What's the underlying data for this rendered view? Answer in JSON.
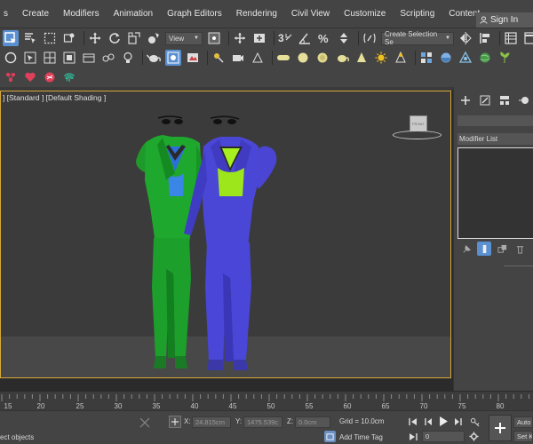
{
  "menu": {
    "items": [
      "s",
      "Create",
      "Modifiers",
      "Animation",
      "Graph Editors",
      "Rendering",
      "Civil View",
      "Customize",
      "Scripting",
      "Content"
    ],
    "signin_label": "Sign In"
  },
  "toolbar": {
    "view_dropdown": "View",
    "selection_set_dropdown": "Create Selection Se"
  },
  "viewport": {
    "label": "] [Standard ] [Default Shading ]",
    "viewcube_label": "FRONT"
  },
  "command_panel": {
    "modifier_list_label": "Modifier List"
  },
  "timeline": {
    "ticks": [
      "15",
      "20",
      "25",
      "30",
      "35",
      "40",
      "45",
      "50",
      "55",
      "60",
      "65",
      "70",
      "75",
      "80"
    ]
  },
  "status": {
    "prompt_text": "ect objects",
    "x_label": "X:",
    "x_value": "24.815cm",
    "y_label": "Y:",
    "y_value": "1475.539c",
    "z_label": "Z:",
    "z_value": "0.0cm",
    "grid_text": "Grid = 10.0cm",
    "add_time_tag_label": "Add Time Tag",
    "frame_value": "0",
    "auto_key_label": "Auto",
    "set_key_label": "Set K"
  },
  "colors": {
    "accent_blue": "#5a8fd0",
    "viewport_border": "#d8a93a",
    "green_suit": "#1fa82e",
    "blue_suit": "#4b47d6",
    "lime_top": "#a6f020"
  }
}
